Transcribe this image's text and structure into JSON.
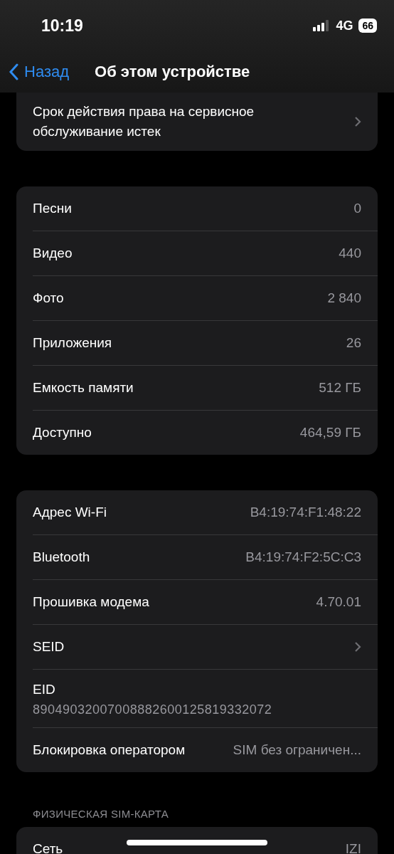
{
  "status_bar": {
    "time": "10:19",
    "network": "4G",
    "battery": "66"
  },
  "nav": {
    "back": "Назад",
    "title": "Об этом устройстве"
  },
  "groups": [
    {
      "rows": [
        {
          "kind": "chevron",
          "label": "Срок действия права на сервисное обслуживание истек"
        }
      ]
    },
    {
      "rows": [
        {
          "kind": "value",
          "label": "Песни",
          "value": "0"
        },
        {
          "kind": "value",
          "label": "Видео",
          "value": "440"
        },
        {
          "kind": "value",
          "label": "Фото",
          "value": "2 840"
        },
        {
          "kind": "value",
          "label": "Приложения",
          "value": "26"
        },
        {
          "kind": "value",
          "label": "Емкость памяти",
          "value": "512 ГБ"
        },
        {
          "kind": "value",
          "label": "Доступно",
          "value": "464,59 ГБ"
        }
      ]
    },
    {
      "rows": [
        {
          "kind": "value",
          "label": "Адрес Wi-Fi",
          "value": "B4:19:74:F1:48:22"
        },
        {
          "kind": "value",
          "label": "Bluetooth",
          "value": "B4:19:74:F2:5C:C3"
        },
        {
          "kind": "value",
          "label": "Прошивка модема",
          "value": "4.70.01"
        },
        {
          "kind": "chevron",
          "label": "SEID"
        },
        {
          "kind": "stacked",
          "label": "EID",
          "value": "89049032007008882600125819332072"
        },
        {
          "kind": "value",
          "label": "Блокировка оператором",
          "value": "SIM без ограничен..."
        }
      ]
    },
    {
      "header": "ФИЗИЧЕСКАЯ SIM-КАРТА",
      "rows": [
        {
          "kind": "value",
          "label": "Сеть",
          "value": "IZI"
        }
      ]
    }
  ]
}
